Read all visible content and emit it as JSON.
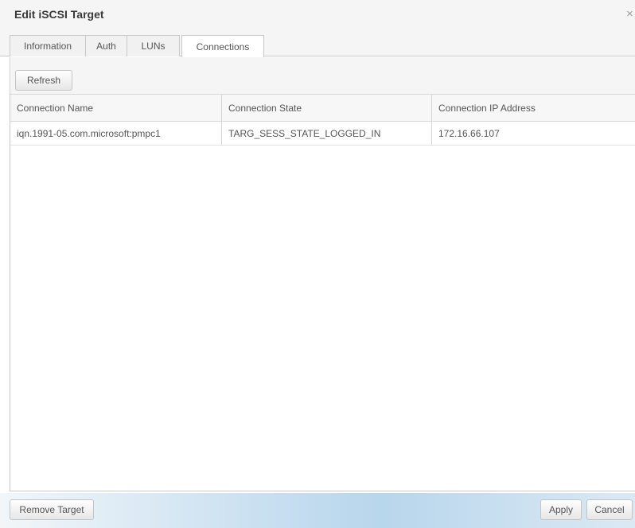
{
  "dialog": {
    "title": "Edit iSCSI Target",
    "close_glyph": "×"
  },
  "tabs": [
    {
      "label": "Information",
      "active": false
    },
    {
      "label": "Auth",
      "active": false
    },
    {
      "label": "LUNs",
      "active": false
    },
    {
      "label": "Connections",
      "active": true
    }
  ],
  "toolbar": {
    "refresh_label": "Refresh"
  },
  "grid": {
    "columns": [
      "Connection Name",
      "Connection State",
      "Connection IP Address"
    ],
    "rows": [
      [
        "iqn.1991-05.com.microsoft:pmpc1",
        "TARG_SESS_STATE_LOGGED_IN",
        "172.16.66.107"
      ]
    ]
  },
  "footer": {
    "remove_label": "Remove Target",
    "apply_label": "Apply",
    "cancel_label": "Cancel"
  },
  "colors": {
    "footer_gradient": "#b8d6ec",
    "header_bg": "#f5f5f5",
    "border": "#c8c8c8"
  }
}
